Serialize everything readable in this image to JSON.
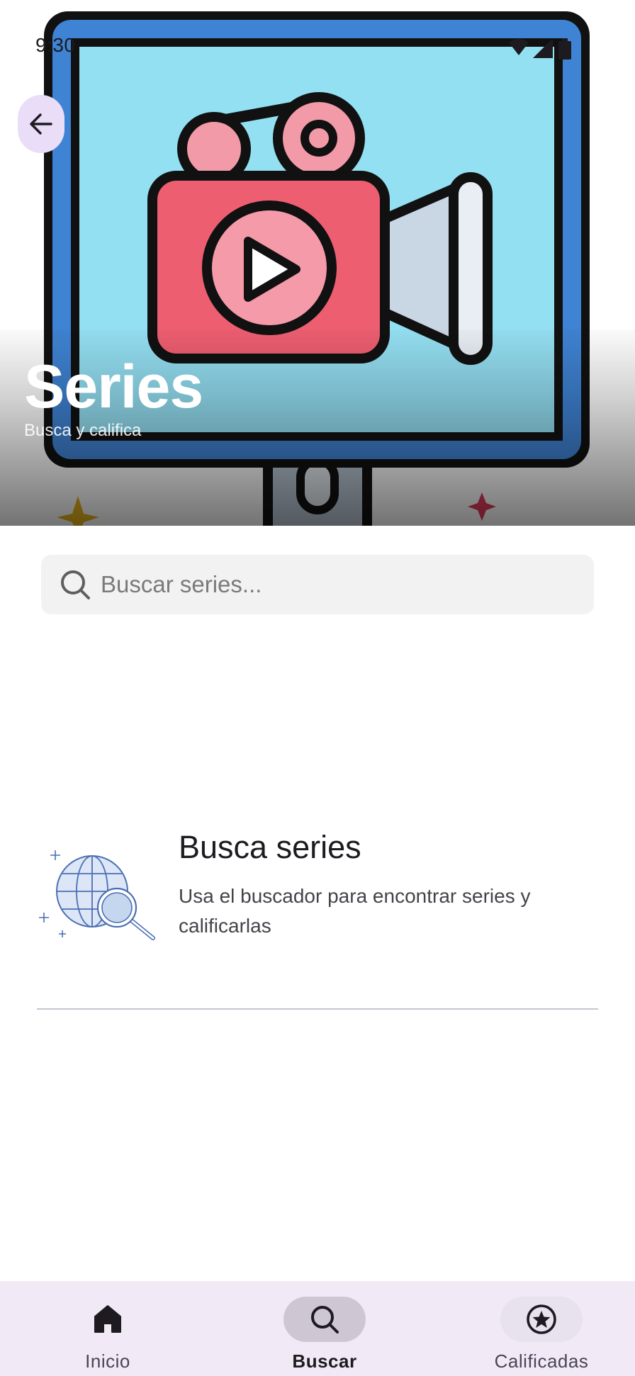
{
  "status_bar": {
    "time": "9:30",
    "icons": [
      "wifi-icon",
      "signal-icon",
      "battery-icon"
    ]
  },
  "header": {
    "back_icon": "arrow-left-icon",
    "title": "Series",
    "subtitle": "Busca y califica",
    "illustration": "video-camera-screen-illustration"
  },
  "search": {
    "placeholder": "Buscar series...",
    "value": "",
    "icon": "search-icon"
  },
  "empty_state": {
    "illustration": "globe-search-illustration",
    "title": "Busca series",
    "message": "Usa el buscador para encontrar series y calificarlas"
  },
  "bottom_nav": {
    "items": [
      {
        "label": "Inicio",
        "icon": "home-icon",
        "active": false
      },
      {
        "label": "Buscar",
        "icon": "search-icon",
        "active": true
      },
      {
        "label": "Calificadas",
        "icon": "star-circle-icon",
        "active": false
      }
    ]
  },
  "colors": {
    "accent_container": "#e9ddf7",
    "nav_background": "#f1eaf6",
    "nav_indicator": "#cfc6d4",
    "search_background": "#f2f2f2",
    "screen_blue": "#94e0f3",
    "frame_blue": "#3f83d4",
    "camera_red": "#ee5e71",
    "camera_pink": "#f59aa9"
  }
}
